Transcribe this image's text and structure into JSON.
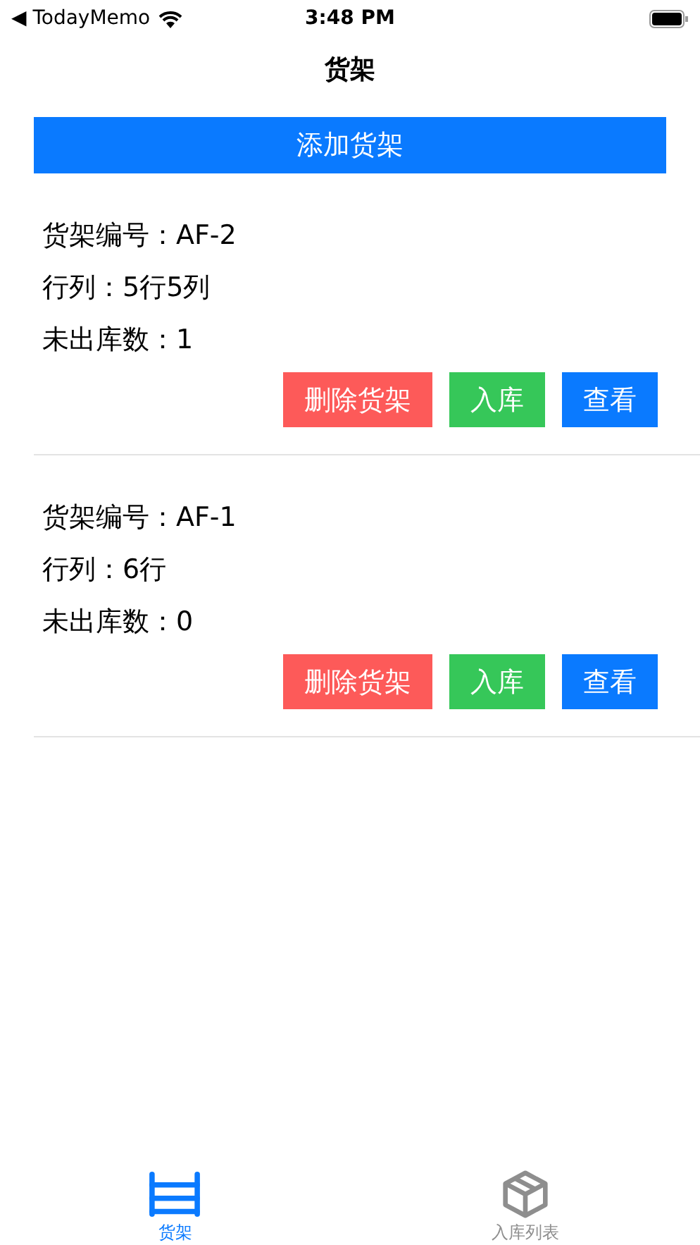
{
  "status_bar": {
    "back_app": "◀ TodayMemo",
    "time": "3:48 PM"
  },
  "nav": {
    "title": "货架"
  },
  "add_button": "添加货架",
  "shelves": [
    {
      "lines": [
        "货架编号：AF-2",
        "行列：5行5列",
        "未出库数：1"
      ],
      "actions": [
        {
          "kind": "delete",
          "label": "删除货架"
        },
        {
          "kind": "stock",
          "label": "入库"
        },
        {
          "kind": "view",
          "label": "查看"
        }
      ]
    },
    {
      "lines": [
        "货架编号：AF-1",
        "行列：6行",
        "未出库数：0"
      ],
      "actions": [
        {
          "kind": "delete",
          "label": "删除货架"
        },
        {
          "kind": "stock",
          "label": "入库"
        },
        {
          "kind": "view",
          "label": "查看"
        }
      ]
    }
  ],
  "tabs": [
    {
      "kind": "shelf",
      "label": "货架",
      "selected": true
    },
    {
      "kind": "box",
      "label": "入库列表",
      "selected": false
    }
  ]
}
